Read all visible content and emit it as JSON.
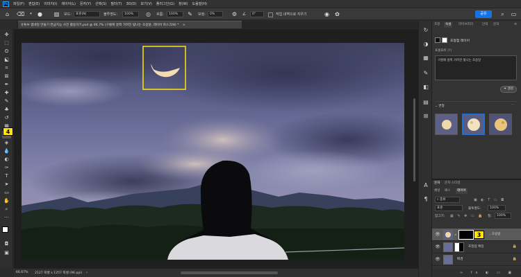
{
  "menu": {
    "app_icon": "Ps",
    "items": [
      "파일(F)",
      "편집(E)",
      "이미지(I)",
      "레이어(L)",
      "문자(Y)",
      "선택(S)",
      "필터(T)",
      "3D(D)",
      "보기(V)",
      "플러그인(G)",
      "창(W)",
      "도움말(H)"
    ]
  },
  "options": {
    "mode_label": "모드:",
    "mode_value": "표준(N)",
    "opacity_label": "불투명도:",
    "opacity_value": "100%",
    "flow_label": "흐름:",
    "flow_value": "100%",
    "smooth_label": "보정:",
    "smooth_value": "0%",
    "angle_value": "0°",
    "erase_history_label": "작업 내역으로 지우기",
    "share_label": "공유"
  },
  "document": {
    "tab_title": "유튜브 썸네일 만들기 연금지능 사진 활용하기.psd @ 66.7% (구름에 살짝 가려진 빛나는 초승달, 레이어 마스크/8) *",
    "tab_close": "×"
  },
  "status": {
    "zoom": "66.67%",
    "doc_size": "2127 픽셀 x 1257 픽셀 (96 ppi)"
  },
  "properties": {
    "tabs": [
      "조정",
      "속성",
      "라이브러리",
      "단락",
      "문자"
    ],
    "active_tab": 1,
    "layer_type": "조정점 레이어",
    "prompt_label": "프롬프트 (?)",
    "prompt_text": "구름에 살짝 가려진 빛나는 초승달",
    "generate_label": "생성",
    "variations_label": "변형",
    "variations_more": "···"
  },
  "layers": {
    "top_tabs": [
      "문자",
      "문자 스타일"
    ],
    "tabs": [
      "채널",
      "패스",
      "레이어"
    ],
    "active_tab": 2,
    "filter_label": "종류",
    "blend_mode": "표준",
    "opacity_label": "불투명도:",
    "opacity_value": "100%",
    "lock_label": "잠그기:",
    "fill_label": "칠:",
    "fill_value": "100%",
    "items": [
      {
        "name": "... 초승달",
        "selected": true
      },
      {
        "name": "조정점 확장",
        "selected": false
      },
      {
        "name": "배경",
        "selected": false
      }
    ]
  },
  "annotations": {
    "badge_4": "4",
    "badge_3": "3",
    "highlight_color": "#ffe600"
  },
  "colors": {
    "accent": "#1473e6",
    "highlight": "#ffe600",
    "selection": "#1f6fd1"
  }
}
